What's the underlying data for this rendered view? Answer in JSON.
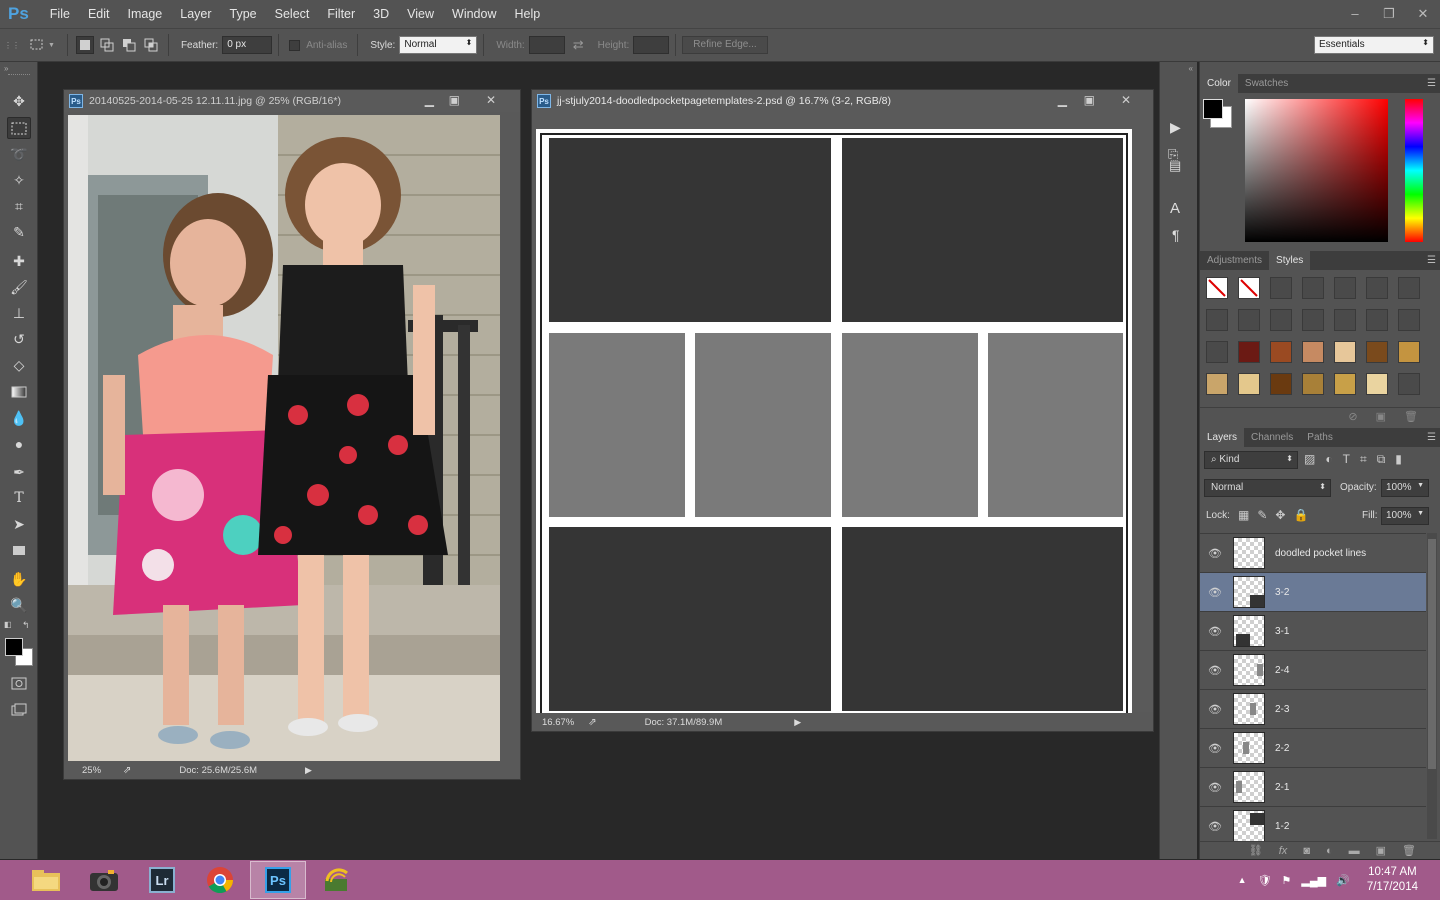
{
  "app": {
    "logo": "Ps",
    "menus": [
      "File",
      "Edit",
      "Image",
      "Layer",
      "Type",
      "Select",
      "Filter",
      "3D",
      "View",
      "Window",
      "Help"
    ],
    "window_controls": [
      "–",
      "❐",
      "✕"
    ]
  },
  "options": {
    "feather_label": "Feather:",
    "feather_value": "0 px",
    "antialias_label": "Anti-alias",
    "style_label": "Style:",
    "style_value": "Normal",
    "width_label": "Width:",
    "height_label": "Height:",
    "refine_edge": "Refine Edge...",
    "workspace": "Essentials"
  },
  "documents": [
    {
      "title": "20140525-2014-05-25 12.11.11.jpg @ 25% (RGB/16*)",
      "zoom": "25%",
      "doc_info": "Doc: 25.6M/25.6M"
    },
    {
      "title": "jj-stjuly2014-doodledpocketpagetemplates-2.psd @ 16.7% (3-2, RGB/8)",
      "zoom": "16.67%",
      "doc_info": "Doc: 37.1M/89.9M"
    }
  ],
  "panels": {
    "color_tabs": [
      "Color",
      "Swatches"
    ],
    "style_tabs": [
      "Adjustments",
      "Styles"
    ],
    "layer_tabs": [
      "Layers",
      "Channels",
      "Paths"
    ],
    "kind_label": "Kind",
    "blend_mode": "Normal",
    "opacity_label": "Opacity:",
    "opacity_value": "100%",
    "lock_label": "Lock:",
    "fill_label": "Fill:",
    "fill_value": "100%",
    "style_swatch_colors": [
      "#6b1a14",
      "#9a4a22",
      "#c68a62",
      "#e7c79a",
      "#7a4a1c",
      "#c49440",
      "#c9a56a",
      "#e4c88c",
      "#6a3a10",
      "#a88038",
      "#c8a048",
      "#ead4a0"
    ]
  },
  "layers": [
    {
      "name": "doodled pocket lines",
      "thumb": "lines",
      "selected": false
    },
    {
      "name": "3-2",
      "thumb": "dark-br",
      "selected": true
    },
    {
      "name": "3-1",
      "thumb": "dark-bl",
      "selected": false
    },
    {
      "name": "2-4",
      "thumb": "grey-r",
      "selected": false
    },
    {
      "name": "2-3",
      "thumb": "grey-mr",
      "selected": false
    },
    {
      "name": "2-2",
      "thumb": "grey-ml",
      "selected": false
    },
    {
      "name": "2-1",
      "thumb": "grey-l",
      "selected": false
    },
    {
      "name": "1-2",
      "thumb": "dark-tr",
      "selected": false
    }
  ],
  "taskbar": {
    "apps": [
      "file-explorer",
      "camera-app",
      "Lr",
      "chrome",
      "Ps",
      "network-app"
    ],
    "time": "10:47 AM",
    "date": "7/17/2014"
  }
}
